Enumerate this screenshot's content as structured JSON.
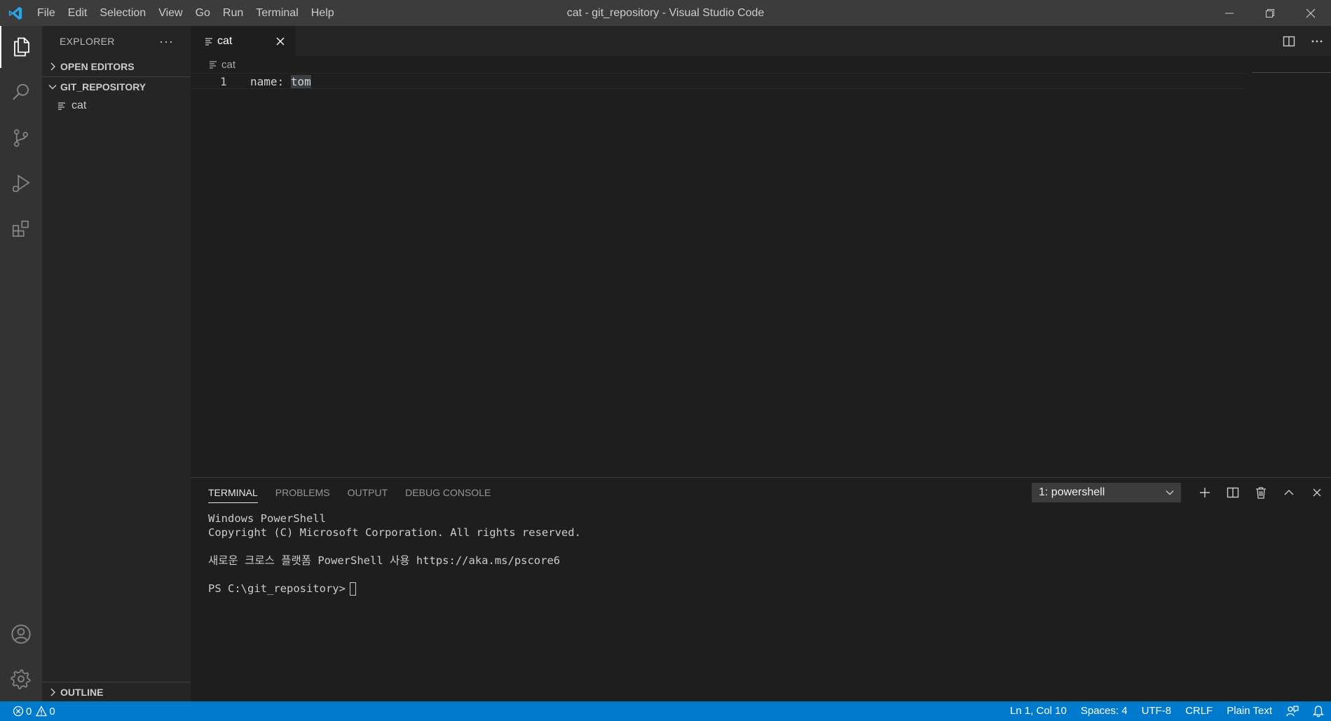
{
  "menu": [
    "File",
    "Edit",
    "Selection",
    "View",
    "Go",
    "Run",
    "Terminal",
    "Help"
  ],
  "window_title": "cat - git_repository - Visual Studio Code",
  "colors": {
    "accent": "#007acc",
    "logo": "#23a9f2"
  },
  "activity_bar": [
    "explorer-icon",
    "search-icon",
    "source-control-icon",
    "run-debug-icon",
    "extensions-icon",
    "account-icon",
    "settings-gear-icon"
  ],
  "sidebar": {
    "title": "EXPLORER",
    "more": "···",
    "open_editors": "OPEN EDITORS",
    "repo": "GIT_REPOSITORY",
    "files": [
      "cat"
    ],
    "outline": "OUTLINE"
  },
  "editor": {
    "tab_label": "cat",
    "breadcrumb": "cat",
    "lines": [
      {
        "num": "1",
        "prefix": "name: ",
        "highlight": "tom"
      }
    ]
  },
  "panel": {
    "tabs": [
      "TERMINAL",
      "PROBLEMS",
      "OUTPUT",
      "DEBUG CONSOLE"
    ],
    "terminal_select": "1: powershell",
    "terminal_lines": [
      "Windows PowerShell",
      "Copyright (C) Microsoft Corporation. All rights reserved.",
      "",
      "새로운 크로스 플랫폼 PowerShell 사용 https://aka.ms/pscore6",
      ""
    ],
    "prompt": "PS C:\\git_repository>"
  },
  "status": {
    "errors": "0",
    "warnings": "0",
    "position": "Ln 1, Col 10",
    "spaces": "Spaces: 4",
    "encoding": "UTF-8",
    "eol": "CRLF",
    "language": "Plain Text"
  }
}
